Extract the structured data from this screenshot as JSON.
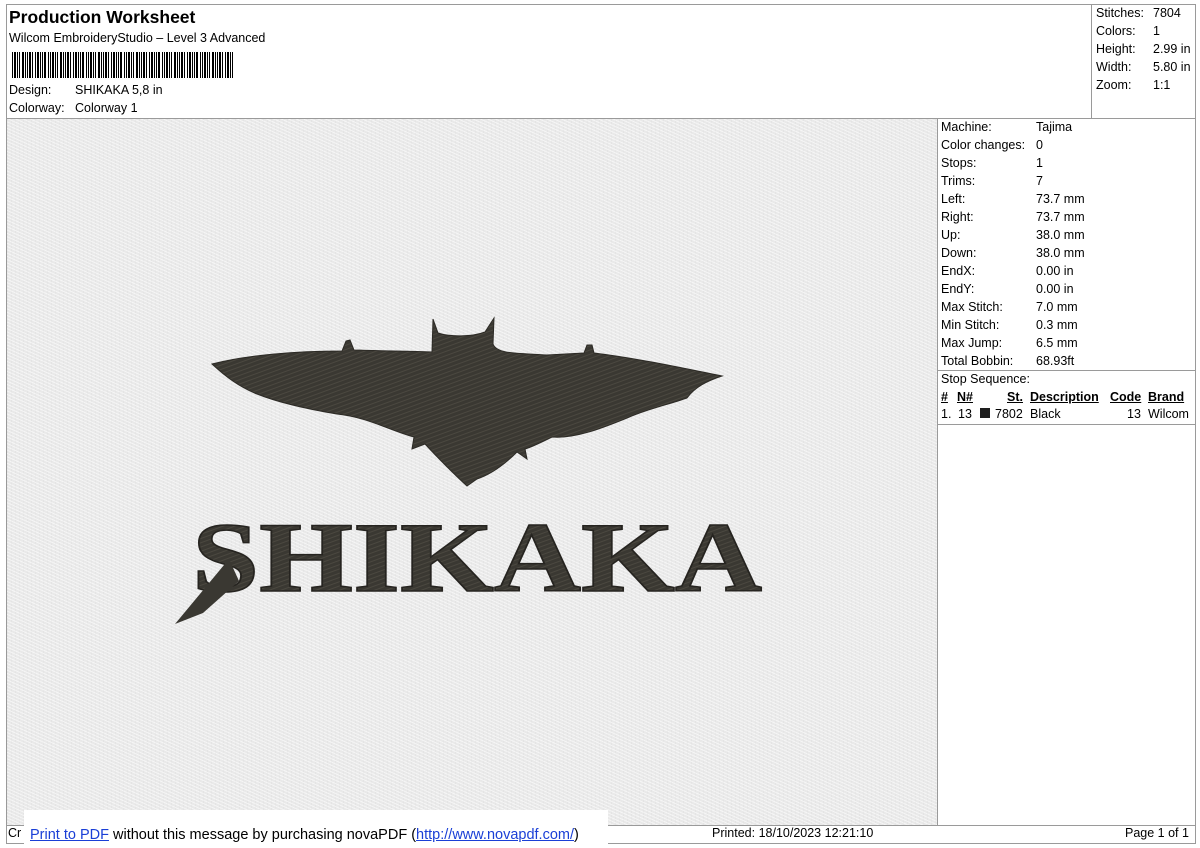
{
  "header": {
    "title": "Production Worksheet",
    "subtitle": "Wilcom EmbroideryStudio – Level 3 Advanced",
    "design_label": "Design:",
    "design_value": "SHIKAKA 5,8 in",
    "colorway_label": "Colorway:",
    "colorway_value": "Colorway 1"
  },
  "stats": {
    "stitches_label": "Stitches:",
    "stitches_value": "7804",
    "colors_label": "Colors:",
    "colors_value": "1",
    "height_label": "Height:",
    "height_value": "2.99 in",
    "width_label": "Width:",
    "width_value": "5.80 in",
    "zoom_label": "Zoom:",
    "zoom_value": "1:1"
  },
  "machine": [
    {
      "label": "Machine:",
      "value": "Tajima"
    },
    {
      "label": "Color changes:",
      "value": "0"
    },
    {
      "label": "Stops:",
      "value": "1"
    },
    {
      "label": "Trims:",
      "value": "7"
    },
    {
      "label": "Left:",
      "value": "73.7 mm"
    },
    {
      "label": "Right:",
      "value": "73.7 mm"
    },
    {
      "label": "Up:",
      "value": "38.0 mm"
    },
    {
      "label": "Down:",
      "value": "38.0 mm"
    },
    {
      "label": "EndX:",
      "value": "0.00 in"
    },
    {
      "label": "EndY:",
      "value": "0.00 in"
    },
    {
      "label": "Max Stitch:",
      "value": "7.0 mm"
    },
    {
      "label": "Min Stitch:",
      "value": "0.3 mm"
    },
    {
      "label": "Max Jump:",
      "value": "6.5 mm"
    },
    {
      "label": "Total Bobbin:",
      "value": "68.93ft"
    }
  ],
  "sequence": {
    "title": "Stop Sequence:",
    "headers": {
      "num": "#",
      "n": "N#",
      "st": "St.",
      "description": "Description",
      "code": "Code",
      "brand": "Brand"
    },
    "rows": [
      {
        "num": "1.",
        "n": "13",
        "st": "7802",
        "description": "Black",
        "code": "13",
        "brand": "Wilcom",
        "swatch_color": "#1e1e1e"
      }
    ]
  },
  "design": {
    "text": "SHIKAKA",
    "thread_color": "#3a3832",
    "background_color": "#e9e9e9"
  },
  "footer": {
    "cut_text": "Cr",
    "banner_link": "Print to PDF",
    "banner_middle": " without this message by purchasing novaPDF (",
    "banner_url": "http://www.novapdf.com/",
    "banner_end": ")",
    "printed_label": "Printed:",
    "printed_value": "18/10/2023 12:21:10",
    "page_text": "Page 1 of 1"
  }
}
